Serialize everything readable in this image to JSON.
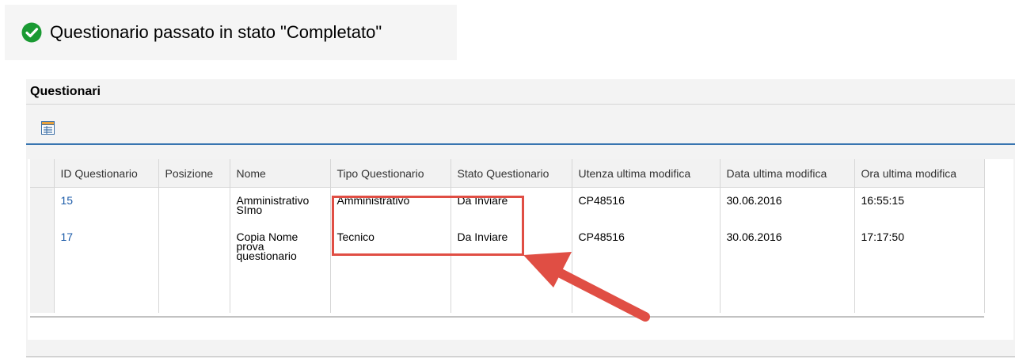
{
  "message": {
    "icon": "check-circle-icon",
    "text": "Questionario passato in stato \"Completato\""
  },
  "section": {
    "title": "Questionari",
    "toolbar_icon": "table-settings-icon"
  },
  "table": {
    "columns": [
      "ID Questionario",
      "Posizione",
      "Nome",
      "Tipo Questionario",
      "Stato Questionario",
      "Utenza ultima modifica",
      "Data ultima modifica",
      "Ora ultima modifica"
    ],
    "rows": [
      {
        "id": "15",
        "posizione": "",
        "nome": "Amministrativo SImo",
        "tipo": "Amministrativo",
        "stato": "Da Inviare",
        "utenza": "CP48516",
        "data": "30.06.2016",
        "ora": "16:55:15"
      },
      {
        "id": "17",
        "posizione": "",
        "nome": "Copia Nome prova questionario",
        "tipo": "Tecnico",
        "stato": "Da Inviare",
        "utenza": "CP48516",
        "data": "30.06.2016",
        "ora": "17:17:50"
      }
    ]
  },
  "colors": {
    "success": "#1a9a33",
    "link": "#1a5aa8",
    "highlight": "#e04e44",
    "accent_line": "#3875b0"
  }
}
